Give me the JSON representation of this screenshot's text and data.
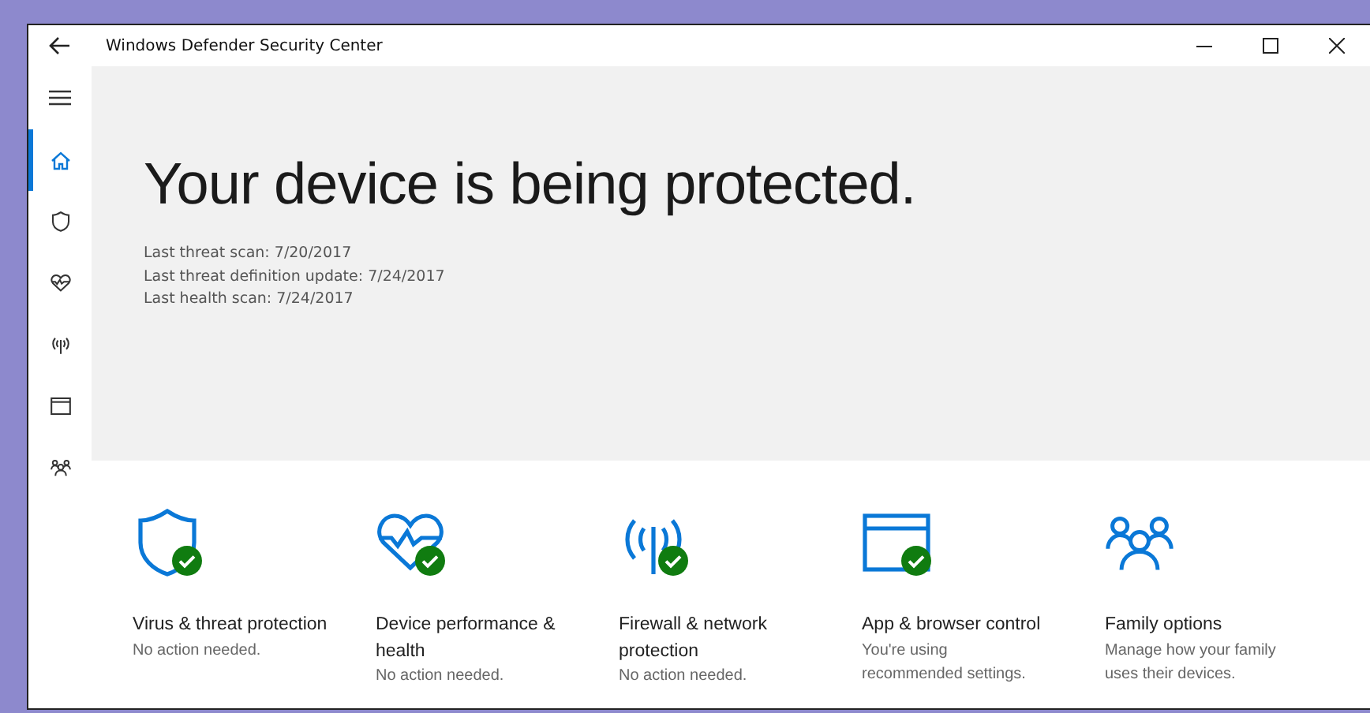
{
  "window": {
    "title": "Windows Defender Security Center"
  },
  "sidebar": {
    "items": [
      {
        "kind": "menu",
        "selected": false
      },
      {
        "kind": "home",
        "selected": true
      },
      {
        "kind": "shield",
        "selected": false
      },
      {
        "kind": "heart",
        "selected": false
      },
      {
        "kind": "antenna",
        "selected": false
      },
      {
        "kind": "browser",
        "selected": false
      },
      {
        "kind": "family",
        "selected": false
      }
    ]
  },
  "hero": {
    "heading": "Your device is being protected.",
    "details": [
      "Last threat scan:  7/20/2017",
      "Last threat definition update:  7/24/2017",
      "Last health scan:  7/24/2017"
    ]
  },
  "tiles": [
    {
      "kind": "shield",
      "title": "Virus & threat protection",
      "status": "No action needed.",
      "ok": true
    },
    {
      "kind": "heart",
      "title": "Device performance & health",
      "status": "No action needed.",
      "ok": true
    },
    {
      "kind": "antenna",
      "title": "Firewall & network protection",
      "status": "No action needed.",
      "ok": true
    },
    {
      "kind": "browser",
      "title": "App & browser control",
      "status": "You're using recommended settings.",
      "ok": true
    },
    {
      "kind": "family",
      "title": "Family options",
      "status": "Manage how your family uses their devices.",
      "ok": false
    }
  ]
}
